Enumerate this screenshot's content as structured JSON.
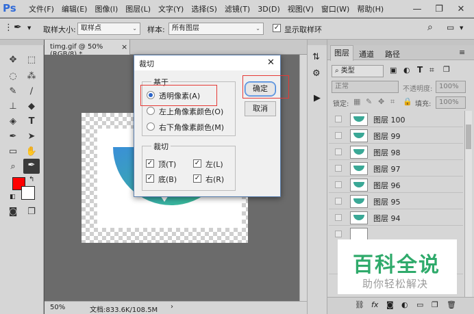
{
  "app": {
    "logo": "Ps"
  },
  "menu": {
    "items": [
      "文件(F)",
      "编辑(E)",
      "图像(I)",
      "图层(L)",
      "文字(Y)",
      "选择(S)",
      "滤镜(T)",
      "3D(D)",
      "视图(V)",
      "窗口(W)",
      "帮助(H)"
    ],
    "window_buttons": {
      "minimize": "—",
      "restore": "❐",
      "close": "✕"
    }
  },
  "options_bar": {
    "sample_size_label": "取样大小:",
    "sample_size_value": "取样点",
    "sample_label": "样本:",
    "sample_value": "所有图层",
    "show_ring_label": "显示取样环",
    "show_ring_checked": true
  },
  "colors": {
    "foreground": "#ff0000",
    "background": "#ffffff",
    "accent": "#2a64c8",
    "highlight_box": "#e53935"
  },
  "document": {
    "tab_title": "timg.gif @ 50%(RGB/8) *",
    "tab_close": "×",
    "zoom": "50%",
    "doc_size": "文档:833.6K/108.5M"
  },
  "dialog": {
    "title": "裁切",
    "close": "✕",
    "based_on": {
      "legend": "基于",
      "options": [
        {
          "label": "透明像素(A)",
          "selected": true
        },
        {
          "label": "左上角像素颜色(O)",
          "selected": false
        },
        {
          "label": "右下角像素颜色(M)",
          "selected": false
        }
      ]
    },
    "trim": {
      "legend": "裁切",
      "options": [
        {
          "label": "顶(T)",
          "checked": true
        },
        {
          "label": "左(L)",
          "checked": true
        },
        {
          "label": "底(B)",
          "checked": true
        },
        {
          "label": "右(R)",
          "checked": true
        }
      ]
    },
    "ok_label": "确定",
    "cancel_label": "取消"
  },
  "layers_panel": {
    "tabs": [
      "图层",
      "通道",
      "路径"
    ],
    "filter_label": "类型",
    "blend_mode": "正常",
    "opacity_label": "不透明度:",
    "opacity_value": "100%",
    "lock_label": "锁定:",
    "fill_label": "填充:",
    "fill_value": "100%",
    "layers": [
      "图层 100",
      "图层 99",
      "图层 98",
      "图层 97",
      "图层 96",
      "图层 95",
      "图层 94"
    ]
  },
  "watermark": {
    "title": "百科全说",
    "subtitle": "助你轻松解决"
  }
}
